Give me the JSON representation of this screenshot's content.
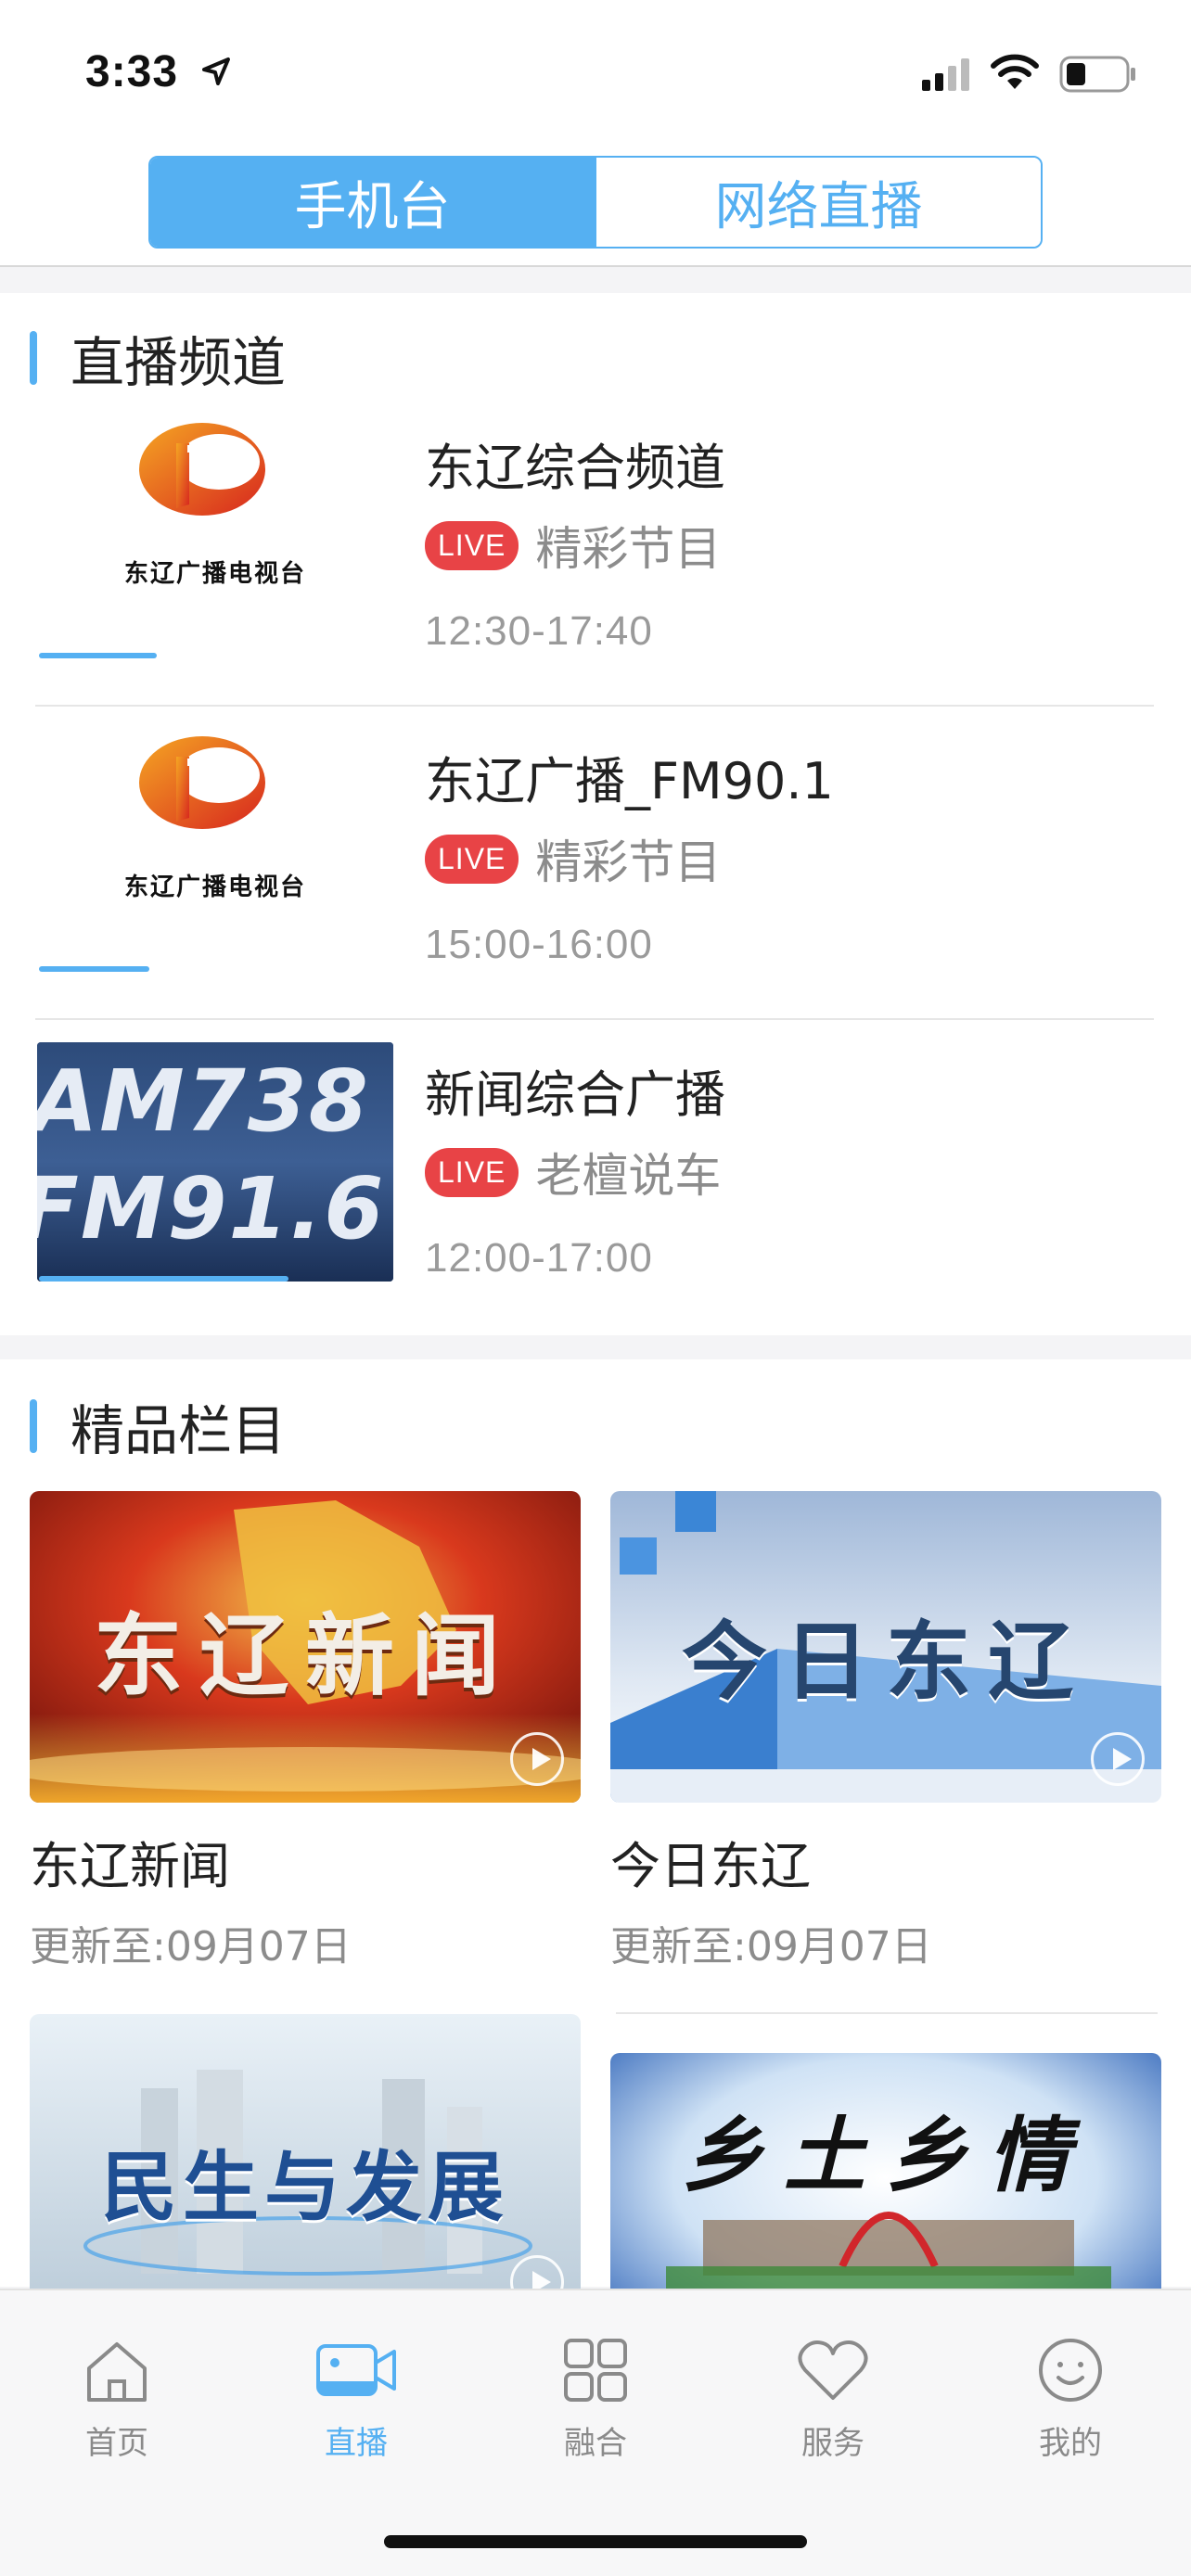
{
  "status": {
    "time": "3:33"
  },
  "header": {
    "tab_active": "手机台",
    "tab_inactive": "网络直播"
  },
  "live_section": {
    "title": "直播频道",
    "channels": [
      {
        "name": "东辽综合频道",
        "badge": "LIVE",
        "program": "精彩节目",
        "time": "12:30-17:40",
        "thumb": "logo",
        "logo_text": "东辽广播电视台",
        "progress": 0.33
      },
      {
        "name": "东辽广播_FM90.1",
        "badge": "LIVE",
        "program": "精彩节目",
        "time": "15:00-16:00",
        "thumb": "logo",
        "logo_text": "东辽广播电视台",
        "progress": 0.31
      },
      {
        "name": "新闻综合广播",
        "badge": "LIVE",
        "program": "老檀说车",
        "time": "12:00-17:00",
        "thumb": "am",
        "thumb_lines": [
          "AM738",
          "FM91.6"
        ],
        "progress": 0.7
      }
    ]
  },
  "featured_section": {
    "title": "精品栏目",
    "cards": [
      {
        "title": "东辽新闻",
        "date": "更新至:09月07日",
        "image_text": "东辽新闻",
        "theme": "red"
      },
      {
        "title": "今日东辽",
        "date": "更新至:09月07日",
        "image_text": "今日东辽",
        "theme": "blue"
      },
      {
        "title": "",
        "date": "",
        "image_text": "民生与发展",
        "theme": "city"
      },
      {
        "title": "",
        "date": "",
        "image_text": "乡土乡情",
        "theme": "ink"
      }
    ]
  },
  "tabbar": {
    "items": [
      {
        "label": "首页",
        "icon": "home-icon"
      },
      {
        "label": "直播",
        "icon": "camera-icon",
        "active": true
      },
      {
        "label": "融合",
        "icon": "grid-icon"
      },
      {
        "label": "服务",
        "icon": "heart-icon"
      },
      {
        "label": "我的",
        "icon": "smiley-icon"
      }
    ]
  },
  "colors": {
    "accent": "#55b0f2",
    "live_badge": "#e84346"
  }
}
